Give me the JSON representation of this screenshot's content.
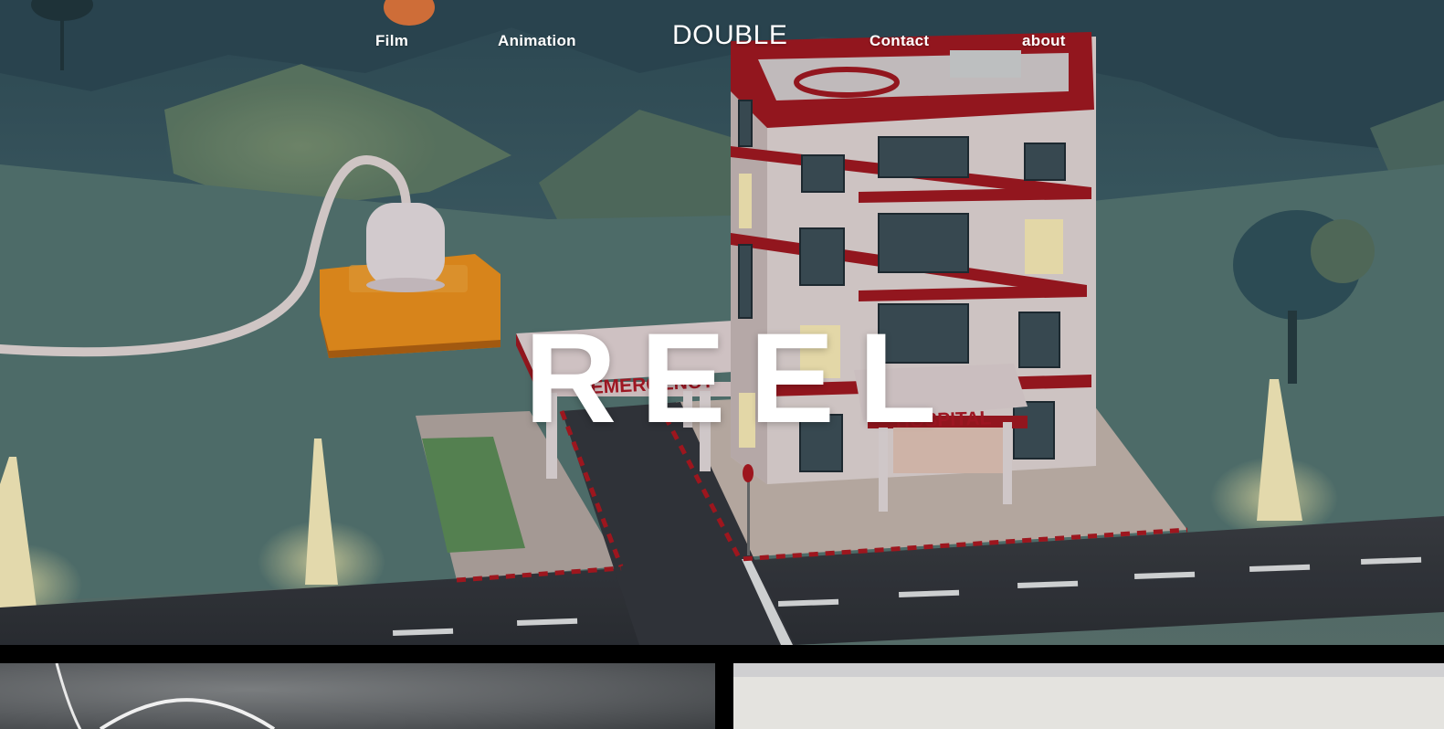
{
  "nav": {
    "film_label": "Film",
    "animation_label": "Animation",
    "brand": "DOUBLE",
    "contact_label": "Contact",
    "about_label": "about"
  },
  "hero": {
    "title": "REEL",
    "scene_signs": {
      "emergency": "EMERGENCY",
      "hospital": "HOSPITAL"
    }
  },
  "colors": {
    "nav_text": "#ffffff",
    "hero_title": "#ffffff",
    "sign_text": "#b01420",
    "building_trim": "#a3141c",
    "power_block": "#f29118"
  }
}
